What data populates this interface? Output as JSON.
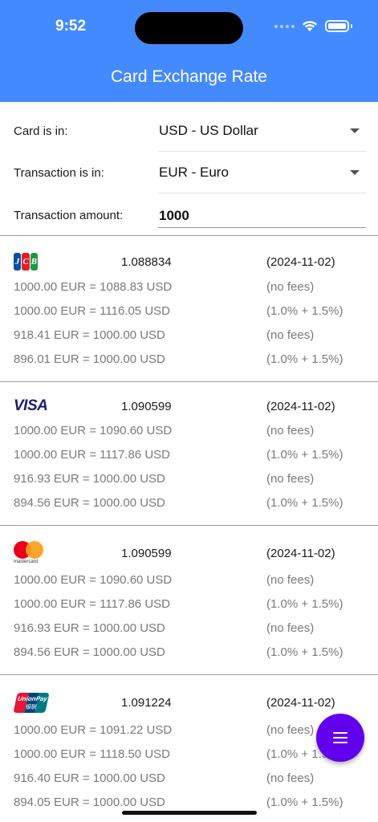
{
  "status_bar": {
    "time": "9:52"
  },
  "app_bar": {
    "title": "Card Exchange Rate"
  },
  "form": {
    "card_label": "Card is in:",
    "card_value": "USD - US Dollar",
    "transaction_label": "Transaction is in:",
    "transaction_value": "EUR - Euro",
    "amount_label": "Transaction amount:",
    "amount_value": "1000"
  },
  "logos": {
    "jcb": [
      "J",
      "C",
      "B"
    ],
    "visa": "VISA",
    "mastercard": "mastercard",
    "unionpay": [
      "UnionPay",
      "银联"
    ]
  },
  "colors": {
    "app_bar": "#448aff",
    "fab": "#6200ee",
    "muted_text": "#7a7a7a"
  },
  "networks": [
    {
      "name": "jcb",
      "rate": "1.088834",
      "date": "(2024-11-02)",
      "rows": [
        {
          "conversion": "1000.00 EUR = 1088.83 USD",
          "fees": "(no fees)"
        },
        {
          "conversion": "1000.00 EUR = 1116.05 USD",
          "fees": "(1.0% + 1.5%)"
        },
        {
          "conversion": "918.41 EUR = 1000.00 USD",
          "fees": "(no fees)"
        },
        {
          "conversion": "896.01 EUR = 1000.00 USD",
          "fees": "(1.0% + 1.5%)"
        }
      ]
    },
    {
      "name": "visa",
      "rate": "1.090599",
      "date": "(2024-11-02)",
      "rows": [
        {
          "conversion": "1000.00 EUR = 1090.60 USD",
          "fees": "(no fees)"
        },
        {
          "conversion": "1000.00 EUR = 1117.86 USD",
          "fees": "(1.0% + 1.5%)"
        },
        {
          "conversion": "916.93 EUR = 1000.00 USD",
          "fees": "(no fees)"
        },
        {
          "conversion": "894.56 EUR = 1000.00 USD",
          "fees": "(1.0% + 1.5%)"
        }
      ]
    },
    {
      "name": "mastercard",
      "rate": "1.090599",
      "date": "(2024-11-02)",
      "rows": [
        {
          "conversion": "1000.00 EUR = 1090.60 USD",
          "fees": "(no fees)"
        },
        {
          "conversion": "1000.00 EUR = 1117.86 USD",
          "fees": "(1.0% + 1.5%)"
        },
        {
          "conversion": "916.93 EUR = 1000.00 USD",
          "fees": "(no fees)"
        },
        {
          "conversion": "894.56 EUR = 1000.00 USD",
          "fees": "(1.0% + 1.5%)"
        }
      ]
    },
    {
      "name": "unionpay",
      "rate": "1.091224",
      "date": "(2024-11-02)",
      "rows": [
        {
          "conversion": "1000.00 EUR = 1091.22 USD",
          "fees": "(no fees)"
        },
        {
          "conversion": "1000.00 EUR = 1118.50 USD",
          "fees": "(1.0% + 1.5%)"
        },
        {
          "conversion": "916.40 EUR = 1000.00 USD",
          "fees": "(no fees)"
        },
        {
          "conversion": "894.05 EUR = 1000.00 USD",
          "fees": "(1.0% + 1.5%)"
        }
      ]
    }
  ],
  "fab": {
    "icon": "menu-icon"
  }
}
